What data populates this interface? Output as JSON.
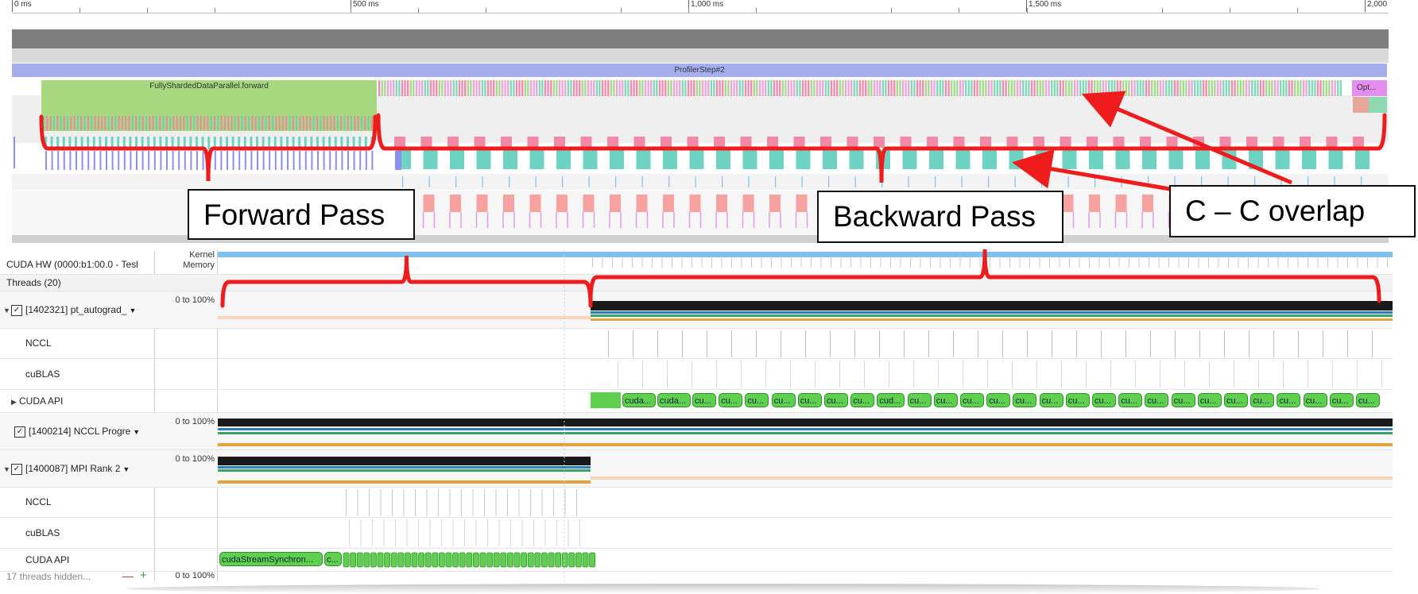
{
  "ruler": {
    "labels": [
      "0 ms",
      "500 ms",
      "1,000 ms",
      "1,500 ms",
      "2,000"
    ]
  },
  "top_timeline": {
    "profiler_step_label": "ProfilerStep#2",
    "forward_label": "FullyShardedDataParallel.forward",
    "opt_label": "Opt..."
  },
  "annotations": {
    "forward_pass": "Forward Pass",
    "backward_pass": "Backward Pass",
    "cc_overlap": "C – C overlap"
  },
  "lower_panel": {
    "cuda_hw_label": "CUDA HW (0000:b1:00.0 - Tesl",
    "kernel_label": "Kernel",
    "memory_label": "Memory",
    "threads_label": "Threads (20)",
    "thread1": {
      "label": "[1402321] pt_autograd_",
      "scale": "0 to 100%",
      "checked": true
    },
    "thread1_nccl": "NCCL",
    "thread1_cublas": "cuBLAS",
    "thread1_cuda_api": "CUDA API",
    "thread2": {
      "label": "[1400214] NCCL Progre",
      "scale": "0 to 100%",
      "checked": true
    },
    "thread3": {
      "label": "[1400087] MPI Rank 2",
      "scale": "0 to 100%",
      "checked": true
    },
    "thread3_nccl": "NCCL",
    "thread3_cublas": "cuBLAS",
    "thread3_cuda_api": "CUDA API",
    "hidden_label": "17 threads hidden...",
    "hidden_minus": "—",
    "hidden_plus": "+",
    "hidden_scale": "0 to 100%",
    "api_chips_thread1": [
      "cuda...",
      "cuda...",
      "cu...",
      "cu...",
      "cu...",
      "cu...",
      "cu...",
      "cu...",
      "cu...",
      "cud...",
      "cu...",
      "cu...",
      "cu...",
      "cu...",
      "cu...",
      "cu...",
      "cu...",
      "cu...",
      "cu...",
      "cu...",
      "cu...",
      "cu...",
      "cu...",
      "cu...",
      "cu...",
      "cu...",
      "cu...",
      "cu..."
    ],
    "api_chips_thread3": [
      "cudaStreamSynchron...",
      "c..."
    ]
  },
  "colors": {
    "annotation_red": "#ee1c1c",
    "forward_green": "#a7d77f",
    "profiler_blue": "#a6aef0",
    "kernel_blue": "#7ec1ef",
    "api_green": "#5ecf4f"
  }
}
